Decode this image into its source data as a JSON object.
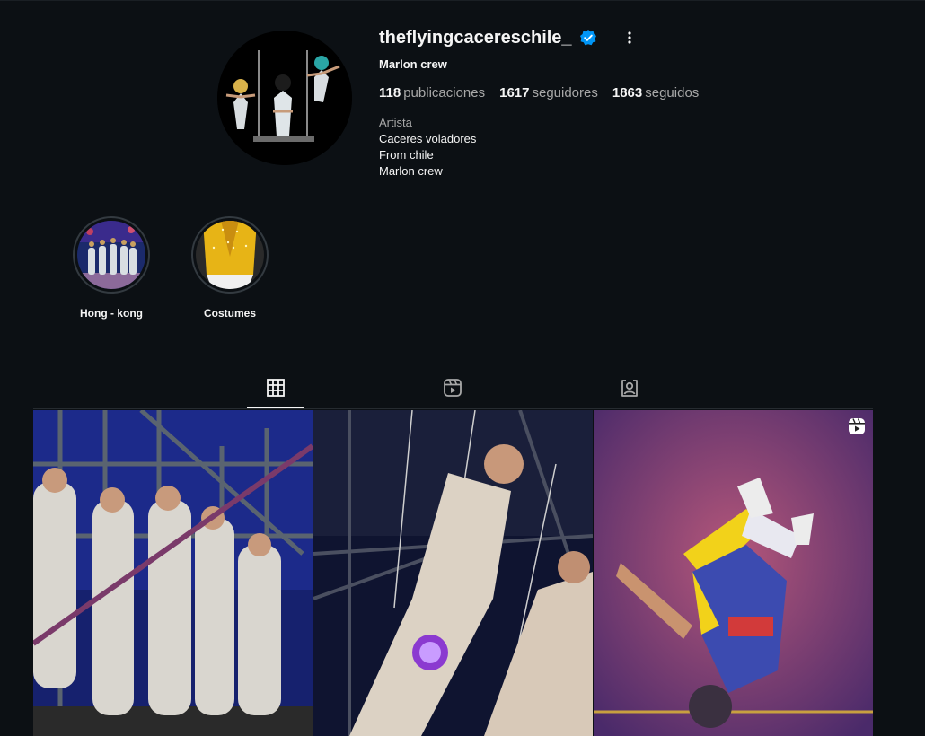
{
  "profile": {
    "username": "theflyingcacereschile_",
    "full_name": "Marlon crew",
    "verified_icon": "verified-badge-icon",
    "more_icon": "more-options-icon",
    "stats": {
      "posts_count": "118",
      "posts_label": "publicaciones",
      "followers_count": "1617",
      "followers_label": "seguidores",
      "following_count": "1863",
      "following_label": "seguidos"
    },
    "category": "Artista",
    "bio_lines": [
      "Caceres voladores",
      "From chile",
      "Marlon crew"
    ]
  },
  "highlights": [
    {
      "label": "Hong - kong"
    },
    {
      "label": "Costumes"
    }
  ],
  "tabs": [
    {
      "name": "posts",
      "icon": "grid-icon",
      "active": true
    },
    {
      "name": "reels",
      "icon": "reels-icon",
      "active": false
    },
    {
      "name": "tagged",
      "icon": "tagged-icon",
      "active": false
    }
  ],
  "posts": [
    {
      "kind": "photo",
      "subject": "trapeze artists on rig"
    },
    {
      "kind": "photo",
      "subject": "flying trapeze performers"
    },
    {
      "kind": "reel",
      "subject": "acrobat upside down",
      "badge_icon": "reel-icon"
    }
  ],
  "colors": {
    "background": "#0c1014",
    "text_primary": "#f5f5f5",
    "text_secondary": "#a8a8a8",
    "verified": "#0095f6"
  }
}
